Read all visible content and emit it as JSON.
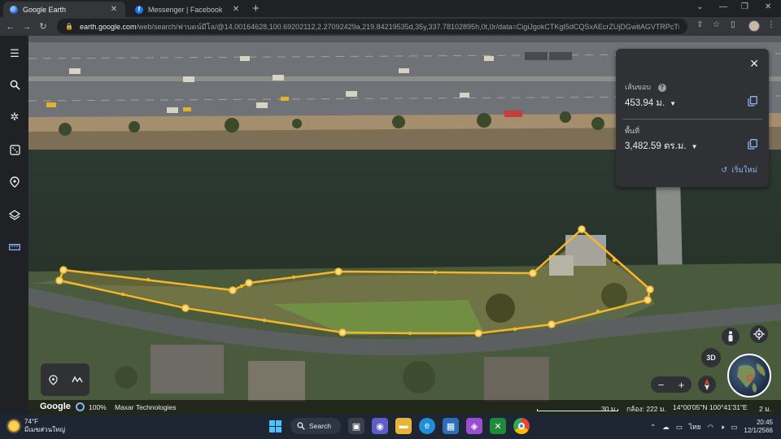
{
  "browser": {
    "tabs": [
      {
        "title": "Google Earth",
        "favicon": "earth-icon",
        "active": true
      },
      {
        "title": "Messenger | Facebook",
        "favicon": "facebook-icon",
        "active": false
      }
    ],
    "url_host": "earth.google.com",
    "url_path": "/web/search/ฟาบดน์มีโล/@14.00164628,100.69202112,2.27092429a,219.84219535d,35y,337.78102895h,0t,0r/data=CigiJgokCTKgI5dCQSxAEcrZUjDGwitAGVTRPcTmO1lAIZ-zTuLvH..."
  },
  "rail": {
    "items": [
      "menu-icon",
      "search-icon",
      "voyager-icon",
      "dice-icon",
      "projects-icon",
      "layers-icon",
      "measure-icon"
    ]
  },
  "measure_panel": {
    "perimeter_label": "เส้นขอบ",
    "perimeter_value": "453.94 ม.",
    "area_label": "พื้นที่",
    "area_value": "3,482.59 ตร.ม.",
    "restart_label": "เริ่มใหม่"
  },
  "map_controls": {
    "button_3d": "3D"
  },
  "status_bar": {
    "logo": "Google",
    "progress": "100%",
    "provider": "Maxar Technologies",
    "scale": "30 ม.",
    "camera": "กล้อง: 222 ม.",
    "coords": "14°00'05\"N 100°41'31\"E",
    "elevation": "2 ม."
  },
  "taskbar": {
    "temperature": "74°F",
    "weather_desc": "มีเมฆส่วนใหญ่",
    "search_label": "Search",
    "language": "ไทย",
    "time": "20:45",
    "date": "12/1/2566"
  },
  "colors": {
    "polygon": "#f5b62a",
    "accent": "#8ab4f8"
  }
}
